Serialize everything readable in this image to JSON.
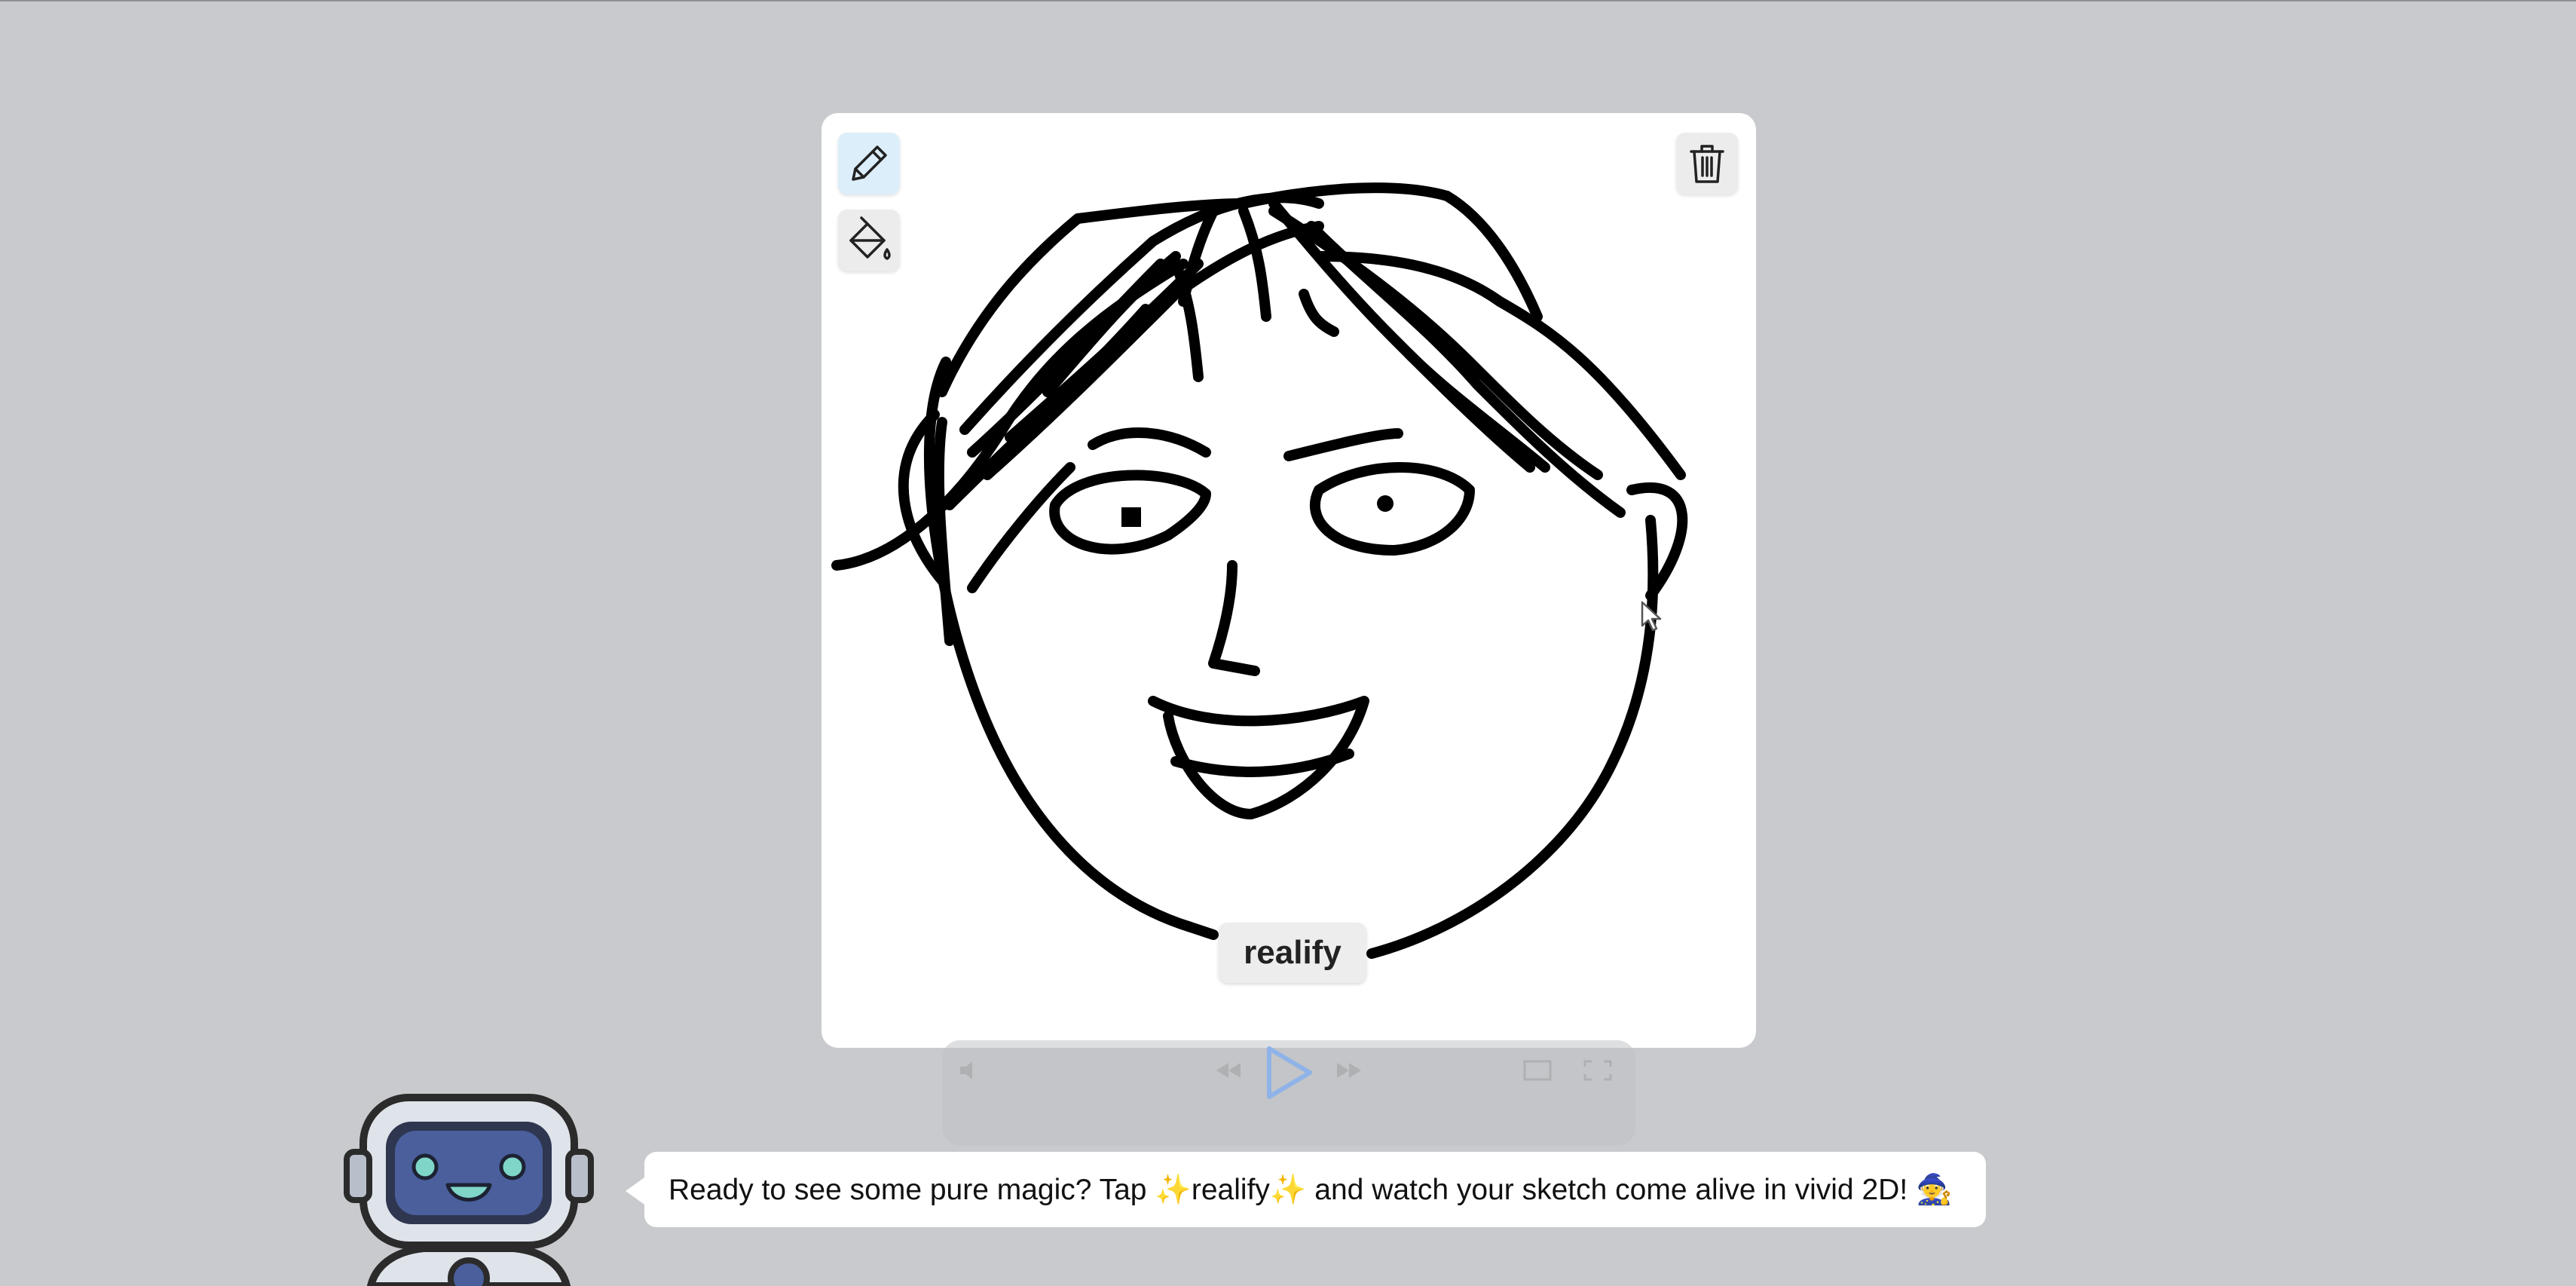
{
  "toolbar": {
    "pencil_tool": "pencil-icon",
    "fill_tool": "paint-bucket-icon",
    "clear_tool": "trash-icon",
    "active_tool": "pencil"
  },
  "canvas": {
    "content": "hand-drawn sketch of a smiling face with messy hair",
    "background": "#ffffff",
    "stroke_color": "#000000"
  },
  "actions": {
    "realify_label": "realify"
  },
  "player": {
    "play_icon": "play-icon",
    "accent": "#8fb3e8"
  },
  "assistant": {
    "avatar_icon": "robot-icon",
    "message": "Ready to see some pure magic? Tap ✨realify✨ and watch your sketch come alive in vivid 2D! 🧙"
  },
  "colors": {
    "page_background": "#c9cacd",
    "pencil_active": "#dceefa",
    "robot_face": "#4a5f9c"
  }
}
